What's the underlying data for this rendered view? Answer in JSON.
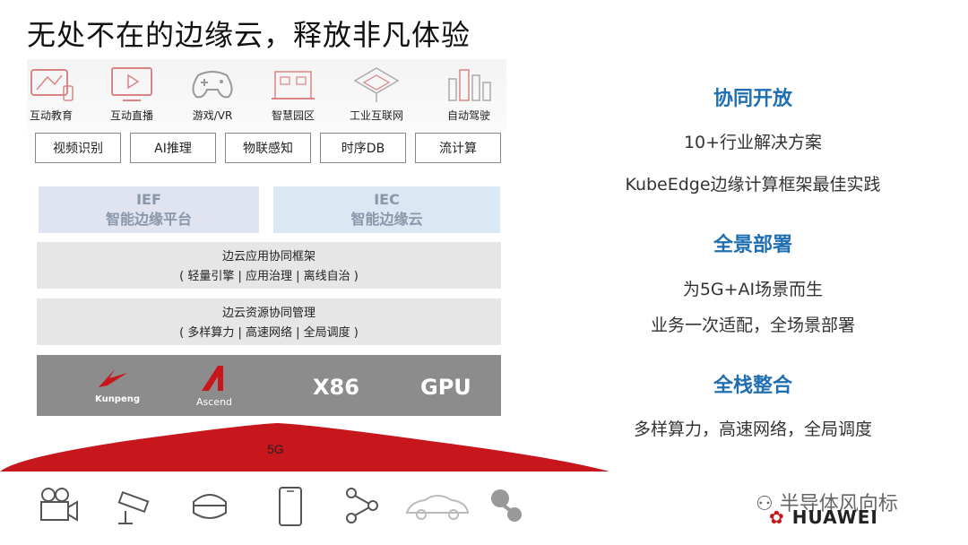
{
  "title": "无处不在的边缘云，释放非凡体验",
  "scenarios": [
    {
      "label": "互动教育",
      "icon": "tablet-icon"
    },
    {
      "label": "互动直播",
      "icon": "live-video-icon"
    },
    {
      "label": "游戏/VR",
      "icon": "gamepad-icon"
    },
    {
      "label": "智慧园区",
      "icon": "campus-icon"
    },
    {
      "label": "工业互联网",
      "icon": "factory-icon"
    },
    {
      "label": "自动驾驶",
      "icon": "city-icon"
    }
  ],
  "capabilities": [
    "视频识别",
    "AI推理",
    "物联感知",
    "时序DB",
    "流计算"
  ],
  "platforms": {
    "ief": {
      "name": "IEF",
      "desc": "智能边缘平台"
    },
    "iec": {
      "name": "IEC",
      "desc": "智能边缘云"
    }
  },
  "layers": [
    {
      "title": "边云应用协同框架",
      "detail": "( 轻量引擎 | 应用治理 | 离线自治 )"
    },
    {
      "title": "边云资源协同管理",
      "detail": "( 多样算力 | 高速网络 | 全局调度 )"
    }
  ],
  "hardware": {
    "kunpeng": "Kunpeng",
    "ascend": "Ascend",
    "x86": "X86",
    "gpu": "GPU"
  },
  "network": "5G",
  "devices": [
    "camcorder-icon",
    "cctv-camera-icon",
    "vr-headset-icon",
    "smartphone-icon",
    "network-nodes-icon",
    "car-icon",
    "robot-icon"
  ],
  "features": [
    {
      "heading": "协同开放",
      "lines": [
        "10+行业解决方案",
        "KubeEdge边缘计算框架最佳实践"
      ]
    },
    {
      "heading": "全景部署",
      "lines": [
        "为5G+AI场景而生",
        "业务一次适配，全场景部署"
      ]
    },
    {
      "heading": "全栈整合",
      "lines": [
        "多样算力，高速网络，全局调度"
      ]
    }
  ],
  "watermark": "半导体风向标",
  "brand": "HUAWEI",
  "colors": {
    "accent_red": "#c8161d",
    "heading_blue": "#1f6fb2"
  }
}
